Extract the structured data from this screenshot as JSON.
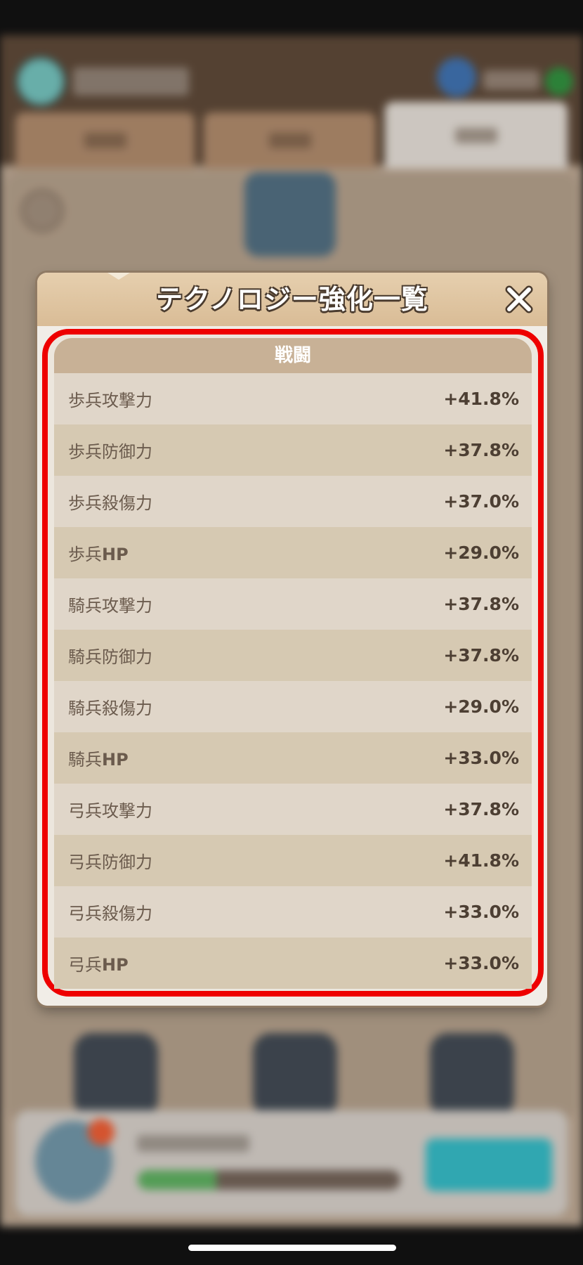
{
  "dialog": {
    "title": "テクノロジー強化一覧",
    "section_title": "戦闘",
    "stats": [
      {
        "name": "歩兵攻撃力",
        "value": "+41.8%"
      },
      {
        "name": "歩兵防御力",
        "value": "+37.8%"
      },
      {
        "name": "歩兵殺傷力",
        "value": "+37.0%"
      },
      {
        "name": "歩兵HP",
        "value": "+29.0%"
      },
      {
        "name": "騎兵攻撃力",
        "value": "+37.8%"
      },
      {
        "name": "騎兵防御力",
        "value": "+37.8%"
      },
      {
        "name": "騎兵殺傷力",
        "value": "+29.0%"
      },
      {
        "name": "騎兵HP",
        "value": "+33.0%"
      },
      {
        "name": "弓兵攻撃力",
        "value": "+37.8%"
      },
      {
        "name": "弓兵防御力",
        "value": "+41.8%"
      },
      {
        "name": "弓兵殺傷力",
        "value": "+33.0%"
      },
      {
        "name": "弓兵HP",
        "value": "+33.0%"
      }
    ]
  },
  "icons": {
    "close": "close-icon"
  },
  "colors": {
    "highlight_border": "#ee0000",
    "header_bg": "#d9bc96",
    "section_header_bg": "#c8b196",
    "row_light": "#e0d6c9",
    "row_dark": "#d6c9b2"
  }
}
